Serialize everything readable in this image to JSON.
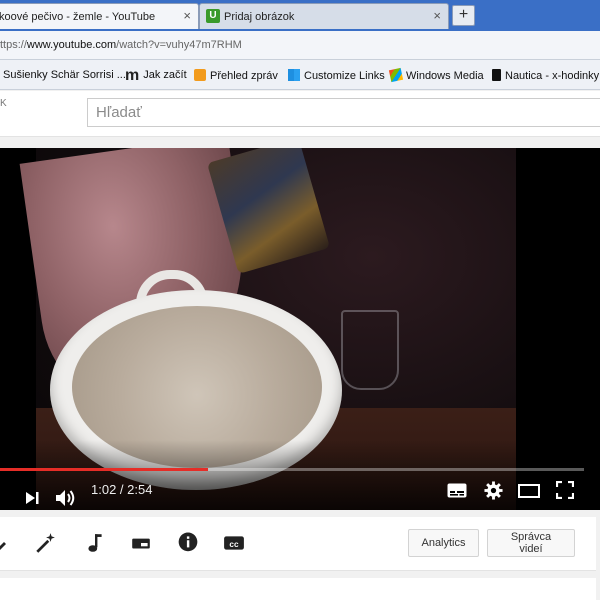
{
  "browser": {
    "tabs": [
      {
        "title": "koové pečivo - žemle - YouTube",
        "active": true
      },
      {
        "title": "Pridaj obrázok",
        "active": false
      }
    ],
    "new_tab_label": "+",
    "close_glyph": "×",
    "url": {
      "prefix": "ttps://",
      "host": "www.youtube.com",
      "path": "/watch?v=vuhy47m7RHM"
    }
  },
  "bookmarks": [
    {
      "label": "Sušienky Schär Sorrisi ...",
      "icon": "blank"
    },
    {
      "label": "Jak začít",
      "icon": "m-logo-icon"
    },
    {
      "label": "Přehled zpráv",
      "icon": "rss-icon"
    },
    {
      "label": "Customize Links",
      "icon": "windows-icon"
    },
    {
      "label": "Windows Media",
      "icon": "windows-flag-icon"
    },
    {
      "label": "Nautica - x-hodinky",
      "icon": "n-logo-icon"
    }
  ],
  "youtube": {
    "header_fragment": "K",
    "search_placeholder": "Hľadať"
  },
  "player": {
    "current_time": "1:02",
    "duration": "2:54",
    "time_separator": " / ",
    "progress_fraction": 0.356,
    "accent_color": "#e52d27"
  },
  "toolbar": {
    "buttons": {
      "analytics": "Analytics",
      "manager": "Správca videí"
    },
    "icons": [
      "pencil-icon",
      "magic-wand-icon",
      "music-note-icon",
      "annotation-icon",
      "info-icon",
      "cc-icon"
    ],
    "cc_label": "cc"
  },
  "below_text": "__ ___ _ _ ___ __ ___ ___ __"
}
